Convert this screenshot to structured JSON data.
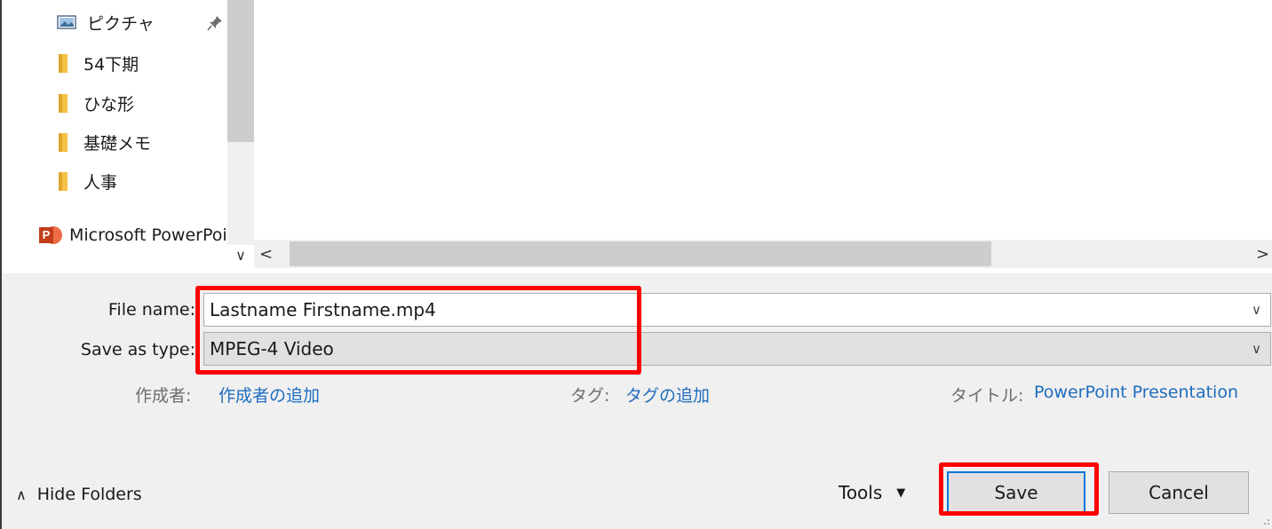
{
  "nav": {
    "items": [
      {
        "label": "ピクチャ",
        "icon": "pictures-icon",
        "pinned": true
      },
      {
        "label": "54下期",
        "icon": "folder-icon"
      },
      {
        "label": "ひな形",
        "icon": "folder-icon"
      },
      {
        "label": "基礎メモ",
        "icon": "folder-icon"
      },
      {
        "label": "人事",
        "icon": "folder-icon"
      }
    ],
    "app_item": {
      "label": "Microsoft PowerPoint",
      "icon": "powerpoint-icon",
      "icon_letter": "P"
    }
  },
  "form": {
    "file_name_label": "File name:",
    "file_name_value": "Lastname Firstname.mp4",
    "save_type_label": "Save as type:",
    "save_type_value": "MPEG-4 Video"
  },
  "meta": {
    "author_label": "作成者:",
    "author_value": "作成者の追加",
    "tags_label": "タグ:",
    "tags_value": "タグの追加",
    "title_label": "タイトル:",
    "title_value": "PowerPoint Presentation"
  },
  "footer": {
    "hide_folders": "Hide Folders",
    "tools": "Tools",
    "save": "Save",
    "cancel": "Cancel"
  },
  "colors": {
    "highlight": "#ff0000",
    "link": "#1f6dbd",
    "primary_border": "#0078d7"
  }
}
